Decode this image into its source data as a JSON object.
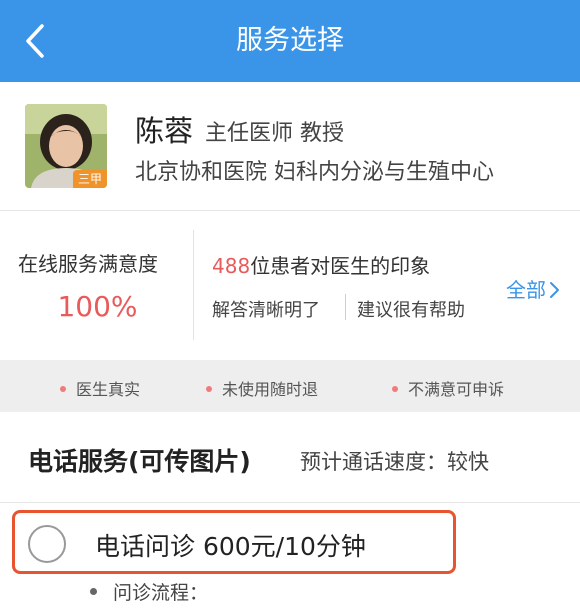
{
  "navbar": {
    "title": "服务选择",
    "back_icon": "chevron-left-icon",
    "background": "#3a95e8"
  },
  "doctor": {
    "name": "陈蓉",
    "title": "主任医师 教授",
    "hospital": "北京协和医院 妇科内分泌与生殖中心",
    "badge": "三甲"
  },
  "stats": {
    "satisfaction_label": "在线服务满意度",
    "satisfaction_value": "100%",
    "impression_count": "488",
    "impression_text": "位患者对医生的印象",
    "tags": [
      "解答清晰明了",
      "建议很有帮助"
    ],
    "all_link": "全部",
    "all_icon": "chevron-right-icon",
    "highlight_color": "#e95a5a"
  },
  "guarantees": {
    "items": [
      "医生真实",
      "未使用随时退",
      "不满意可申诉"
    ]
  },
  "service": {
    "title": "电话服务(可传图片)",
    "speed": "预计通话速度：较快"
  },
  "option": {
    "label": "电话问诊 600元/10分钟",
    "selected": false,
    "border_color": "#e8542f"
  },
  "process": {
    "label": "问诊流程："
  }
}
